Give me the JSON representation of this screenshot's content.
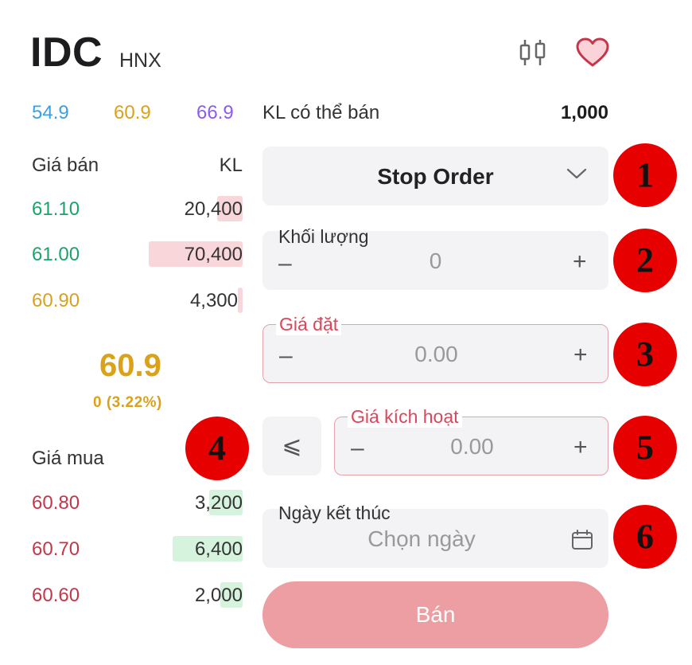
{
  "header": {
    "ticker": "IDC",
    "exchange": "HNX",
    "icons": [
      "candlestick-chart-icon",
      "heart-icon"
    ]
  },
  "reference_prices": {
    "floor": "54.9",
    "reference": "60.9",
    "ceiling": "66.9"
  },
  "order_book": {
    "ask_header": {
      "price": "Giá bán",
      "volume": "KL"
    },
    "asks": [
      {
        "price": "61.10",
        "volume": "20,400",
        "bar_fraction": 0.12
      },
      {
        "price": "61.00",
        "volume": "70,400",
        "bar_fraction": 0.44
      },
      {
        "price": "60.90",
        "volume": "4,300",
        "bar_fraction": 0.02
      }
    ],
    "last_price": "60.9",
    "change": "0 (3.22%)",
    "bid_header": {
      "price": "Giá mua"
    },
    "bids": [
      {
        "price": "60.80",
        "volume": "3,200",
        "bar_fraction": 0.16
      },
      {
        "price": "60.70",
        "volume": "6,400",
        "bar_fraction": 0.33
      },
      {
        "price": "60.60",
        "volume": "2,000",
        "bar_fraction": 0.1
      }
    ]
  },
  "order_form": {
    "sellable_label": "KL có thể bán",
    "sellable_value": "1,000",
    "order_type": "Stop Order",
    "quantity": {
      "label": "Khối lượng",
      "value": "0",
      "minus": "–",
      "plus": "+"
    },
    "price": {
      "label": "Giá đặt",
      "value": "0.00",
      "minus": "–",
      "plus": "+"
    },
    "condition_operator": "⩽",
    "trigger_price": {
      "label": "Giá kích hoạt",
      "value": "0.00",
      "minus": "–",
      "plus": "+"
    },
    "end_date": {
      "label": "Ngày kết thúc",
      "placeholder": "Chọn ngày"
    },
    "submit_label": "Bán"
  },
  "markers": [
    "1",
    "2",
    "3",
    "4",
    "5",
    "6"
  ],
  "colors": {
    "ask_green": "#1aa36b",
    "reference_yellow": "#d9a21a",
    "bid_red": "#c6364a",
    "floor_blue": "#3aa0e6",
    "ceiling_purple": "#8a5cf0",
    "submit_pink": "#ec9ea3",
    "marker_red": "#e60000"
  }
}
